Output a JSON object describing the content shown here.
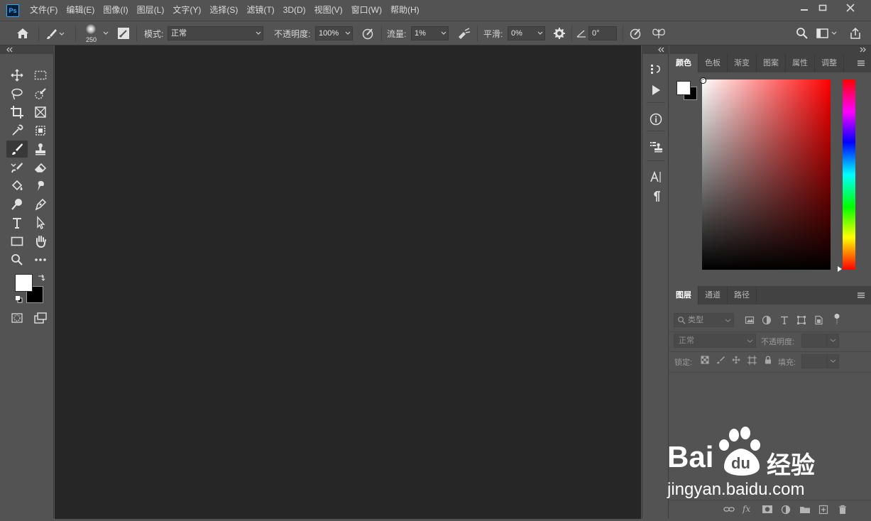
{
  "app": {
    "logo_text": "Ps"
  },
  "menu": [
    "文件(F)",
    "编辑(E)",
    "图像(I)",
    "图层(L)",
    "文字(Y)",
    "选择(S)",
    "滤镜(T)",
    "3D(D)",
    "视图(V)",
    "窗口(W)",
    "帮助(H)"
  ],
  "options": {
    "brush_size": "250",
    "mode_label": "模式:",
    "mode_value": "正常",
    "opacity_label": "不透明度:",
    "opacity_value": "100%",
    "flow_label": "流量:",
    "flow_value": "1%",
    "smoothing_label": "平滑:",
    "smoothing_value": "0%",
    "angle_value": "0°"
  },
  "color_panel": {
    "tabs": [
      "颜色",
      "色板",
      "渐变",
      "图案",
      "属性",
      "调整"
    ],
    "active_tab": 0,
    "foreground": "#ffffff",
    "background": "#000000",
    "hue_color": "#ff0000"
  },
  "layers_panel": {
    "tabs": [
      "图层",
      "通道",
      "路径"
    ],
    "active_tab": 0,
    "filter_placeholder": "类型",
    "blend_mode": "正常",
    "opacity_label": "不透明度:",
    "lock_label": "锁定:",
    "fill_label": "填充:"
  },
  "watermark": {
    "brand": "Bai",
    "brand_suffix": "经验",
    "url": "jingyan.baidu.com",
    "du_text": "du"
  }
}
